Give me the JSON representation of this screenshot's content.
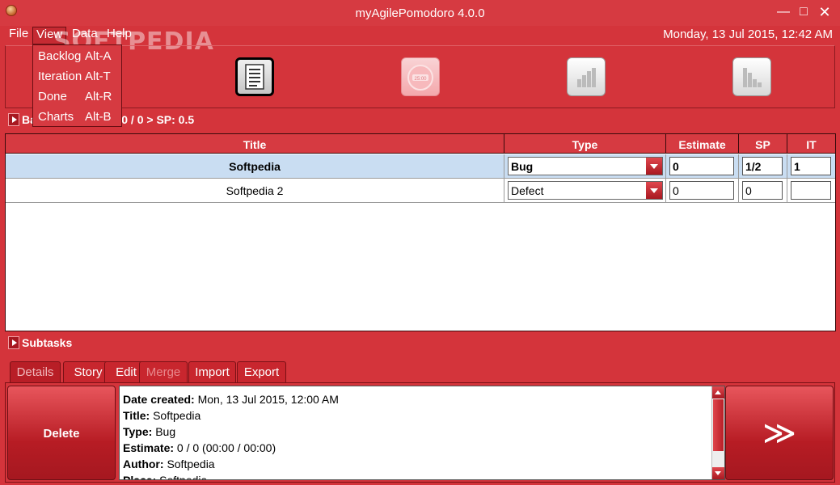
{
  "window": {
    "title": "myAgilePomodoro 4.0.0",
    "min": "—",
    "max": "□",
    "close": "✕"
  },
  "menu": {
    "file": "File",
    "view": "View",
    "data": "Data",
    "help": "Help"
  },
  "datetime": "Monday, 13 Jul 2015, 12:42 AM",
  "watermark": "SOFTPEDIA",
  "view_menu": [
    {
      "label": "Backlog",
      "shortcut": "Alt-A"
    },
    {
      "label": "Iteration",
      "shortcut": "Alt-T"
    },
    {
      "label": "Done",
      "shortcut": "Alt-R"
    },
    {
      "label": "Charts",
      "shortcut": "Alt-B"
    }
  ],
  "toolbar": {
    "buttons": [
      {
        "icon": "document-list-icon",
        "state": "selected"
      },
      {
        "icon": "pomodoro-timer-icon",
        "state": "faded",
        "timer_text": "25:00"
      },
      {
        "icon": "bar-chart-icon",
        "state": "normal"
      },
      {
        "icon": "burndown-chart-icon",
        "state": "normal"
      }
    ]
  },
  "backlog_header": {
    "label_prefix": "Ba",
    "label_suffix": "e: 0 / 0 > SP: 0.5"
  },
  "table": {
    "columns": [
      "Title",
      "Type",
      "Estimate",
      "SP",
      "IT"
    ],
    "rows": [
      {
        "title": "Softpedia",
        "type": "Bug",
        "estimate": "0",
        "sp": "1/2",
        "it": "1",
        "selected": true
      },
      {
        "title": "Softpedia 2",
        "type": "Defect",
        "estimate": "0",
        "sp": "0",
        "it": "",
        "selected": false
      }
    ]
  },
  "subtasks_header": "Subtasks",
  "tabs": [
    "Details",
    "Story",
    "Edit",
    "Merge",
    "Import",
    "Export"
  ],
  "delete_label": "Delete",
  "move_label": "≫",
  "details": [
    {
      "key": "Date created:",
      "value": "Mon, 13 Jul 2015, 12:00 AM"
    },
    {
      "key": "Title:",
      "value": "Softpedia"
    },
    {
      "key": "Type:",
      "value": "Bug"
    },
    {
      "key": "Estimate:",
      "value": "0 / 0 (00:00 / 00:00)"
    },
    {
      "key": "Author:",
      "value": "Softpedia"
    },
    {
      "key": "Place:",
      "value": "Softpedia"
    }
  ]
}
